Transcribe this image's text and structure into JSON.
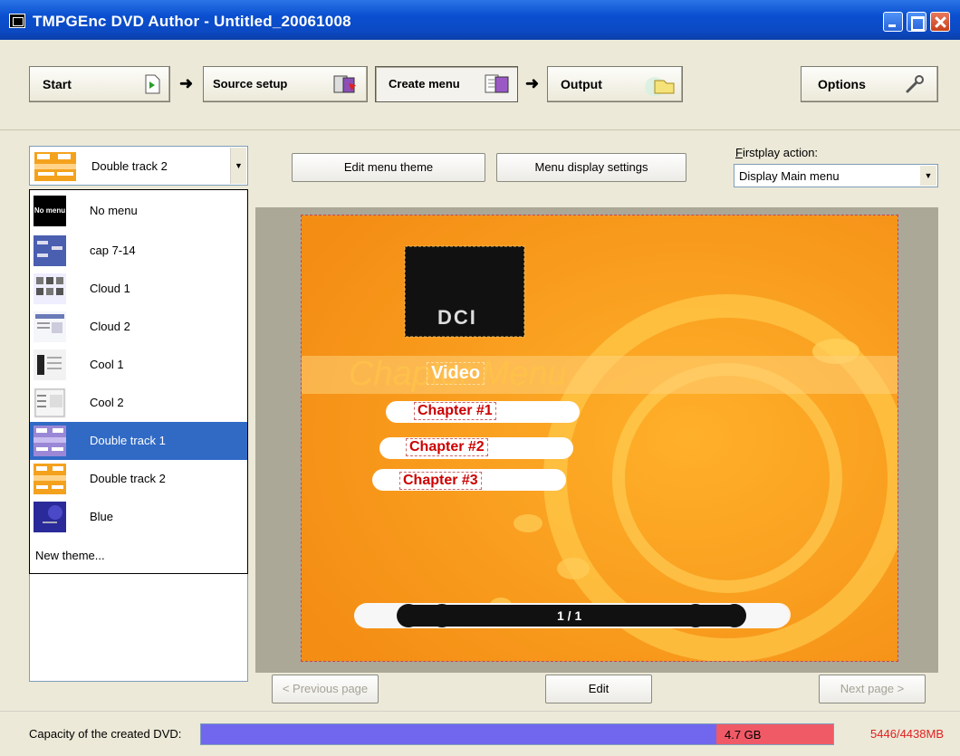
{
  "window": {
    "title": "TMPGEnc DVD Author - Untitled_20061008"
  },
  "steps": [
    {
      "label": "Start",
      "icon": "page-arrow-icon"
    },
    {
      "label": "Source setup",
      "icon": "film-add-icon"
    },
    {
      "label": "Create menu",
      "icon": "menu-doc-icon",
      "active": true
    },
    {
      "label": "Output",
      "icon": "folder-disc-icon"
    }
  ],
  "options": {
    "label": "Options",
    "icon": "wrench-icon"
  },
  "menu_theme": {
    "selected": "Double track 2"
  },
  "toolbar": {
    "edit_theme": "Edit menu theme",
    "display_settings": "Menu display settings"
  },
  "firstplay": {
    "label_hotkey": "F",
    "label_rest": "irstplay action:",
    "value": "Display Main menu"
  },
  "theme_list": {
    "items": [
      {
        "label": "No menu",
        "thumb_text": "No menu"
      },
      {
        "label": "cap 7-14"
      },
      {
        "label": "Cloud 1"
      },
      {
        "label": "Cloud 2"
      },
      {
        "label": "Cool 1"
      },
      {
        "label": "Cool 2"
      },
      {
        "label": "Double track 1",
        "selected": true
      },
      {
        "label": "Double track 2"
      },
      {
        "label": "Blue"
      }
    ],
    "new_theme": "New theme..."
  },
  "preview": {
    "logo": "DCI",
    "bg_title": "Chapter Menu",
    "title": "Video",
    "chapters": [
      "Chapter #1",
      "Chapter #2",
      "Chapter #3"
    ],
    "page_indicator": "1 / 1"
  },
  "nav": {
    "prev": "< Previous page",
    "edit": "Edit",
    "next": "Next page >"
  },
  "capacity": {
    "label": "Capacity of the created DVD:",
    "gb_label": "4.7 GB",
    "used_mb": 5446,
    "capacity_mb": 4438,
    "usage_text": "5446/4438MB"
  },
  "colors": {
    "accent": "#316ac5",
    "capacity_fill": "#7067ee",
    "over_capacity": "#f05a66",
    "chapter_red": "#cc0000",
    "menu_orange": "#f7a21b"
  }
}
